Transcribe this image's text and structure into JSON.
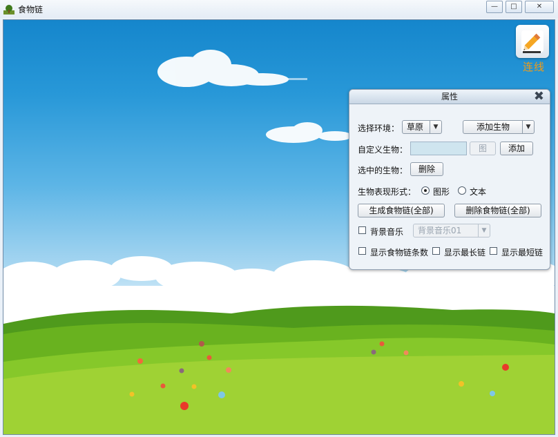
{
  "window": {
    "title": "食物链",
    "minimize_glyph": "—",
    "maximize_glyph": "□",
    "close_glyph": "✕"
  },
  "toolbar": {
    "draw_label": "连线",
    "draw_icon": "pencil-icon"
  },
  "panel": {
    "title": "属性",
    "close_glyph": "✖",
    "environment_label": "选择环境：",
    "environment_value": "草原",
    "add_creature_label": "添加生物",
    "custom_creature_label": "自定义生物：",
    "custom_creature_value": "",
    "image_button_label": "图",
    "add_button_label": "添加",
    "selected_creature_label": "选中的生物：",
    "delete_button_label": "删除",
    "display_mode_label": "生物表现形式：",
    "mode_graphic": "图形",
    "mode_text": "文本",
    "selected_mode": "图形",
    "generate_chain_label": "生成食物链(全部)",
    "delete_chain_label": "删除食物链(全部)",
    "bg_music_label": "背景音乐",
    "bg_music_checked": false,
    "bg_music_value": "背景音乐01",
    "show_chain_count_label": "显示食物链条数",
    "show_chain_count_checked": false,
    "show_longest_label": "显示最长链",
    "show_longest_checked": false,
    "show_shortest_label": "显示最短链",
    "show_shortest_checked": false
  },
  "scene": {
    "sky_color": "#1a88cc",
    "grass_color": "#7ec520",
    "accent_color": "#f19b16"
  }
}
